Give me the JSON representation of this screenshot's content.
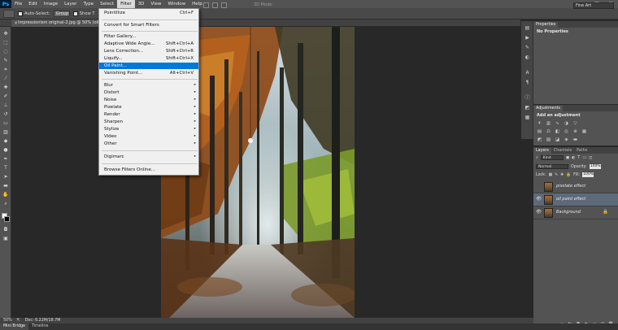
{
  "app": {
    "logo": "Ps"
  },
  "menubar": [
    "File",
    "Edit",
    "Image",
    "Layer",
    "Type",
    "Select",
    "Filter",
    "3D",
    "View",
    "Window",
    "Help"
  ],
  "window_controls": {
    "minimize": "–",
    "restore": "□",
    "close": "✕"
  },
  "options": {
    "auto_select_label": "Auto-Select:",
    "auto_select_value": "Group",
    "show_label": "Show T",
    "mode_3d": "3D Mode:",
    "workspace": "Fine Art"
  },
  "document_tab": {
    "title": "Impressionism original-2.jpg @ 50% (oil paint eff",
    "close": "×"
  },
  "filter_menu": {
    "items": [
      {
        "label": "Pointillize",
        "shortcut": "Ctrl+F"
      },
      {
        "label": "Convert for Smart Filters",
        "shortcut": ""
      },
      {
        "label": "Filter Gallery...",
        "shortcut": ""
      },
      {
        "label": "Adaptive Wide Angle...",
        "shortcut": "Shift+Ctrl+A"
      },
      {
        "label": "Lens Correction...",
        "shortcut": "Shift+Ctrl+R"
      },
      {
        "label": "Liquify...",
        "shortcut": "Shift+Ctrl+X"
      },
      {
        "label": "Oil Paint...",
        "shortcut": ""
      },
      {
        "label": "Vanishing Point...",
        "shortcut": "Alt+Ctrl+V"
      },
      {
        "label": "Blur",
        "shortcut": ""
      },
      {
        "label": "Distort",
        "shortcut": ""
      },
      {
        "label": "Noise",
        "shortcut": ""
      },
      {
        "label": "Pixelate",
        "shortcut": ""
      },
      {
        "label": "Render",
        "shortcut": ""
      },
      {
        "label": "Sharpen",
        "shortcut": ""
      },
      {
        "label": "Stylize",
        "shortcut": ""
      },
      {
        "label": "Video",
        "shortcut": ""
      },
      {
        "label": "Other",
        "shortcut": ""
      },
      {
        "label": "Digimarc",
        "shortcut": ""
      },
      {
        "label": "Browse Filters Online...",
        "shortcut": ""
      }
    ],
    "highlighted": "Oil Paint...",
    "submenu_arrow": "▸"
  },
  "properties_panel": {
    "tab": "Properties",
    "message": "No Properties"
  },
  "adjustments_panel": {
    "tab": "Adjustments",
    "heading": "Add an adjustment"
  },
  "layers_panel": {
    "tabs": [
      "Layers",
      "Channels",
      "Paths"
    ],
    "filter_kind": "Kind",
    "blend_mode": "Normal",
    "opacity_label": "Opacity:",
    "opacity_value": "100%",
    "lock_label": "Lock:",
    "fill_label": "Fill:",
    "fill_value": "100%",
    "layers": [
      {
        "name": "pixelate effect",
        "visible": false,
        "selected": false,
        "locked": false
      },
      {
        "name": "oil paint effect",
        "visible": true,
        "selected": true,
        "locked": false
      },
      {
        "name": "Background",
        "visible": true,
        "selected": false,
        "locked": true
      }
    ]
  },
  "status": {
    "zoom": "50%",
    "doc": "Doc: 6.22M/18.7M"
  },
  "bottom_tabs": [
    "Mini Bridge",
    "Timeline"
  ],
  "icons": {
    "eye": "👁",
    "lock": "🔒",
    "dropdown": "▾"
  }
}
